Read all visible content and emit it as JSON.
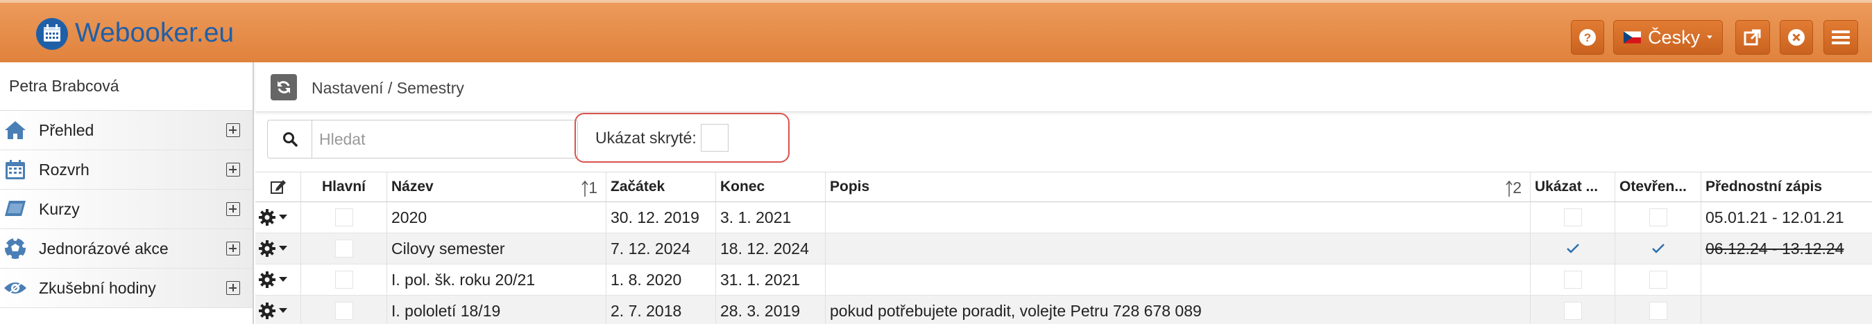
{
  "app": {
    "brand": "Webooker.eu",
    "language": "Česky"
  },
  "sidebar": {
    "user_name": "Petra Brabcová",
    "items": [
      {
        "label": "Přehled",
        "icon": "home-icon"
      },
      {
        "label": "Rozvrh",
        "icon": "calendar-icon"
      },
      {
        "label": "Kurzy",
        "icon": "book-icon"
      },
      {
        "label": "Jednorázové akce",
        "icon": "soccer-ball-icon"
      },
      {
        "label": "Zkušební hodiny",
        "icon": "eye-icon"
      }
    ]
  },
  "breadcrumb": "Nastavení / Semestry",
  "search": {
    "placeholder": "Hledat",
    "value": ""
  },
  "filter": {
    "show_hidden_label": "Ukázat skryté:",
    "show_hidden_checked": false
  },
  "table": {
    "columns": {
      "main": "Hlavní",
      "name": "Název",
      "name_sort": "1",
      "start": "Začátek",
      "end": "Konec",
      "description": "Popis",
      "description_sort": "2",
      "show": "Ukázat ...",
      "open": "Otevřen...",
      "priority": "Přednostní zápis"
    },
    "rows": [
      {
        "name": "2020",
        "start": "30. 12. 2019",
        "end": "3. 1. 2021",
        "description": "",
        "show": false,
        "open": false,
        "priority": "05.01.21 - 12.01.21",
        "priority_struck": false
      },
      {
        "name": "Cilovy semester",
        "start": "7. 12. 2024",
        "end": "18. 12. 2024",
        "description": "",
        "show": true,
        "open": true,
        "priority": "06.12.24 - 13.12.24",
        "priority_struck": true
      },
      {
        "name": "I. pol. šk. roku 20/21",
        "start": "1. 8. 2020",
        "end": "31. 1. 2021",
        "description": "",
        "show": false,
        "open": false,
        "priority": "",
        "priority_struck": false
      },
      {
        "name": "I. pololetí 18/19",
        "start": "2. 7. 2018",
        "end": "28. 3. 2019",
        "description": "pokud potřebujete poradit, volejte Petru 728 678 089",
        "show": false,
        "open": false,
        "priority": "",
        "priority_struck": false
      }
    ]
  },
  "colors": {
    "header_orange": "#e58a45",
    "brand_blue": "#1f5fa8",
    "highlight_red": "#d9534f",
    "check_blue": "#2a6fb0"
  }
}
